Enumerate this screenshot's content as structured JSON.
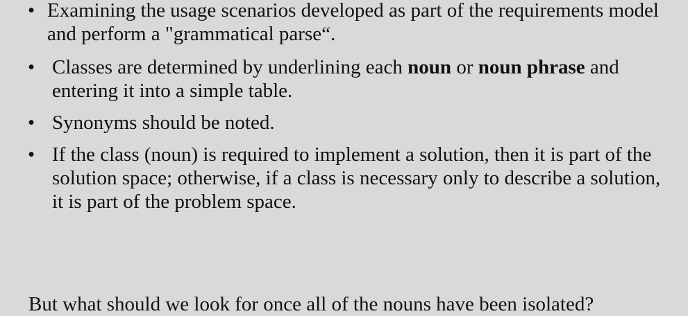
{
  "bullets": [
    {
      "text_parts": [
        "Examining the usage scenarios developed as part of the requirements model and perform a \"grammatical parse“."
      ]
    },
    {
      "text_parts": [
        "Classes are determined by underlining each ",
        "noun",
        " or ",
        "noun phrase",
        " and entering it into a simple table."
      ]
    },
    {
      "text_parts": [
        "Synonyms should be noted."
      ]
    },
    {
      "text_parts": [
        "If the class (noun) is required to implement a solution, then it is part of the solution space; otherwise, if a class is necessary only to describe a solution, it is part of the problem space."
      ]
    }
  ],
  "bullet_symbol": "•",
  "footer": {
    "question": "But what should we look for once all of the nouns have been isolated?"
  }
}
